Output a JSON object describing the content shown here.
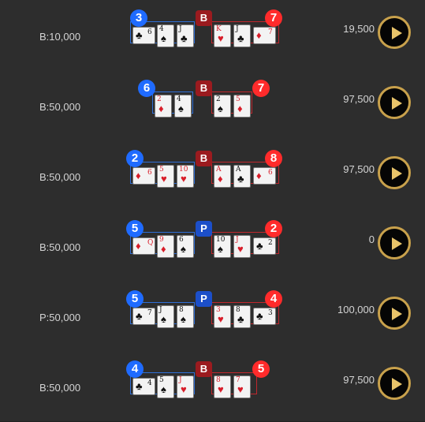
{
  "rows": [
    {
      "bet": "B:10,000",
      "payout": "19,500",
      "result": "B",
      "player": {
        "score": "3",
        "cards": [
          {
            "rank": "6",
            "suit": "♣",
            "color": "black",
            "side": true
          },
          {
            "rank": "4",
            "suit": "♠",
            "color": "black"
          },
          {
            "rank": "J",
            "suit": "♣",
            "color": "black"
          }
        ]
      },
      "banker": {
        "score": "7",
        "cards": [
          {
            "rank": "K",
            "suit": "♥",
            "color": "red"
          },
          {
            "rank": "J",
            "suit": "♣",
            "color": "black"
          },
          {
            "rank": "7",
            "suit": "♦",
            "color": "red",
            "side": true
          }
        ]
      }
    },
    {
      "bet": "B:50,000",
      "payout": "97,500",
      "result": "B",
      "player": {
        "score": "6",
        "cards": [
          {
            "rank": "2",
            "suit": "♦",
            "color": "red"
          },
          {
            "rank": "4",
            "suit": "♠",
            "color": "black"
          }
        ]
      },
      "banker": {
        "score": "7",
        "cards": [
          {
            "rank": "2",
            "suit": "♠",
            "color": "black"
          },
          {
            "rank": "5",
            "suit": "♦",
            "color": "red"
          }
        ]
      }
    },
    {
      "bet": "B:50,000",
      "payout": "97,500",
      "result": "B",
      "player": {
        "score": "2",
        "cards": [
          {
            "rank": "6",
            "suit": "♦",
            "color": "red",
            "side": true
          },
          {
            "rank": "5",
            "suit": "♥",
            "color": "red"
          },
          {
            "rank": "10",
            "suit": "♥",
            "color": "red"
          }
        ]
      },
      "banker": {
        "score": "8",
        "cards": [
          {
            "rank": "A",
            "suit": "♦",
            "color": "red"
          },
          {
            "rank": "A",
            "suit": "♣",
            "color": "black"
          },
          {
            "rank": "6",
            "suit": "♦",
            "color": "red",
            "side": true
          }
        ]
      }
    },
    {
      "bet": "B:50,000",
      "payout": "0",
      "result": "P",
      "player": {
        "score": "5",
        "cards": [
          {
            "rank": "Q",
            "suit": "♦",
            "color": "red",
            "side": true
          },
          {
            "rank": "9",
            "suit": "♦",
            "color": "red"
          },
          {
            "rank": "6",
            "suit": "♠",
            "color": "black"
          }
        ]
      },
      "banker": {
        "score": "2",
        "cards": [
          {
            "rank": "10",
            "suit": "♠",
            "color": "black"
          },
          {
            "rank": "J",
            "suit": "♥",
            "color": "red"
          },
          {
            "rank": "2",
            "suit": "♣",
            "color": "black",
            "side": true
          }
        ]
      }
    },
    {
      "bet": "P:50,000",
      "payout": "100,000",
      "result": "P",
      "player": {
        "score": "5",
        "cards": [
          {
            "rank": "7",
            "suit": "♣",
            "color": "black",
            "side": true
          },
          {
            "rank": "J",
            "suit": "♠",
            "color": "black"
          },
          {
            "rank": "8",
            "suit": "♠",
            "color": "black"
          }
        ]
      },
      "banker": {
        "score": "4",
        "cards": [
          {
            "rank": "3",
            "suit": "♥",
            "color": "red"
          },
          {
            "rank": "8",
            "suit": "♣",
            "color": "black"
          },
          {
            "rank": "3",
            "suit": "♣",
            "color": "black",
            "side": true
          }
        ]
      }
    },
    {
      "bet": "B:50,000",
      "payout": "97,500",
      "result": "B",
      "player": {
        "score": "4",
        "cards": [
          {
            "rank": "4",
            "suit": "♣",
            "color": "black",
            "side": true
          },
          {
            "rank": "5",
            "suit": "♠",
            "color": "black"
          },
          {
            "rank": "J",
            "suit": "♥",
            "color": "red"
          }
        ]
      },
      "banker": {
        "score": "5",
        "cards": [
          {
            "rank": "8",
            "suit": "♥",
            "color": "red"
          },
          {
            "rank": "7",
            "suit": "♥",
            "color": "red"
          }
        ]
      }
    }
  ]
}
